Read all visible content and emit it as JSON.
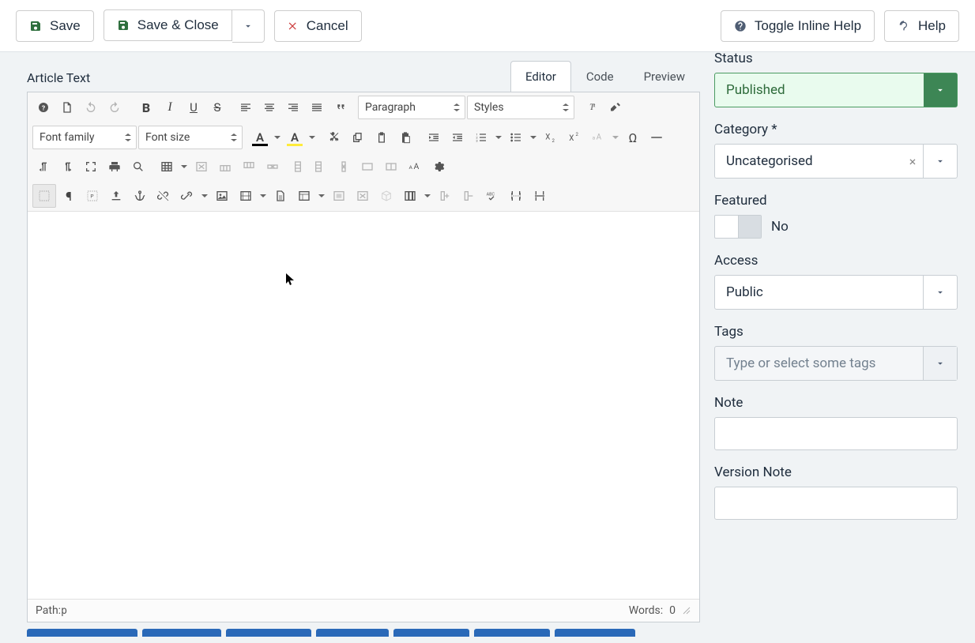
{
  "actions": {
    "save": "Save",
    "save_close": "Save & Close",
    "cancel": "Cancel",
    "toggle_help": "Toggle Inline Help",
    "help": "Help"
  },
  "editor": {
    "section_label": "Article Text",
    "tabs": {
      "editor": "Editor",
      "code": "Code",
      "preview": "Preview"
    },
    "selects": {
      "paragraph": "Paragraph",
      "styles": "Styles",
      "font_family": "Font family",
      "font_size": "Font size"
    },
    "status": {
      "path_label": "Path: ",
      "path_element": "p",
      "words_label": "Words: ",
      "words_count": "0"
    }
  },
  "sidebar": {
    "status": {
      "label": "Status",
      "value": "Published"
    },
    "category": {
      "label": "Category *",
      "value": "Uncategorised"
    },
    "featured": {
      "label": "Featured",
      "value": "No"
    },
    "access": {
      "label": "Access",
      "value": "Public"
    },
    "tags": {
      "label": "Tags",
      "placeholder": "Type or select some tags"
    },
    "note": {
      "label": "Note"
    },
    "version_note": {
      "label": "Version Note"
    }
  },
  "bottom_tabs_widths": [
    140,
    100,
    108,
    92,
    96,
    96,
    102
  ]
}
